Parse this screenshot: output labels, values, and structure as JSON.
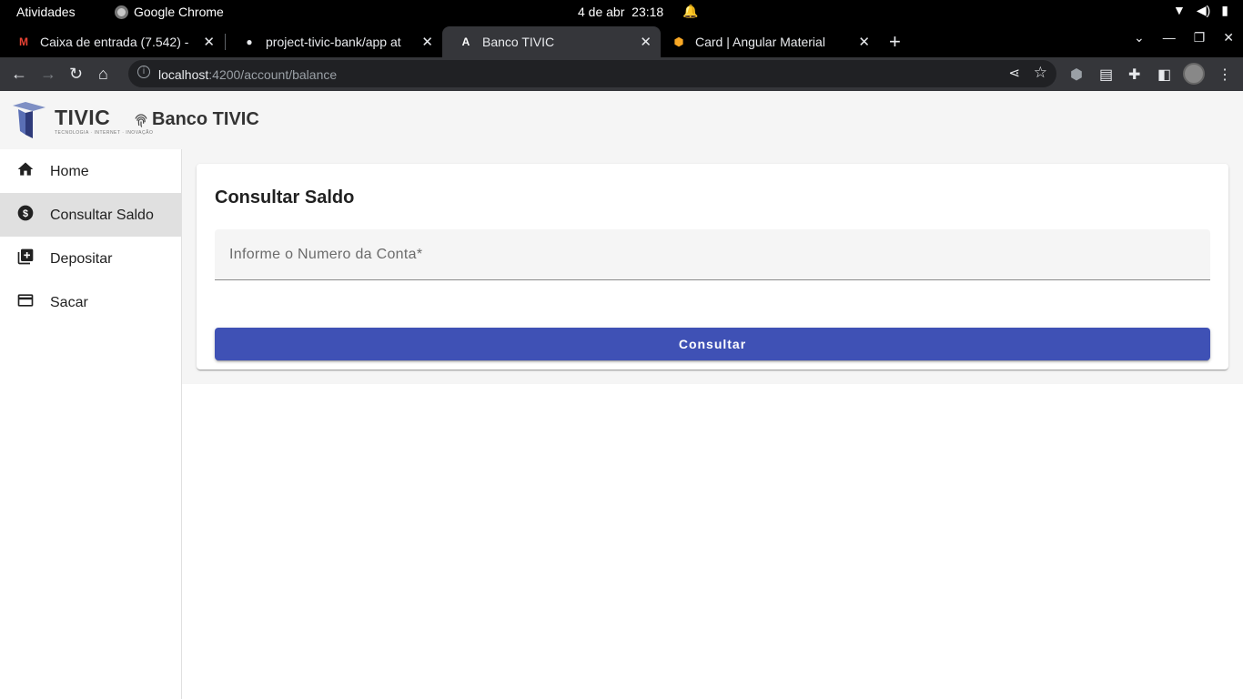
{
  "os_bar": {
    "activities": "Atividades",
    "app_name": "Google Chrome",
    "date": "4 de abr",
    "time": "23:18"
  },
  "browser": {
    "tabs": [
      {
        "title": "Caixa de entrada (7.542) -",
        "favicon": "gmail-icon",
        "favicon_color": "#ea4335"
      },
      {
        "title": "project-tivic-bank/app at",
        "favicon": "github-icon",
        "favicon_color": "#e8eaed"
      },
      {
        "title": "Banco TIVIC",
        "favicon": "angular-icon",
        "favicon_color": "#ffffff"
      },
      {
        "title": "Card | Angular Material",
        "favicon": "shield-icon",
        "favicon_color": "#f9a825"
      }
    ],
    "url_host": "localhost",
    "url_path": ":4200/account/balance"
  },
  "header": {
    "logo_text": "TIVIC",
    "logo_tagline": "TECNOLOGIA · INTERNET · INOVAÇÃO",
    "title": "Banco TIVIC"
  },
  "sidebar": {
    "items": [
      {
        "label": "Home",
        "icon": "home-icon"
      },
      {
        "label": "Consultar Saldo",
        "icon": "dollar-icon"
      },
      {
        "label": "Depositar",
        "icon": "add-box-icon"
      },
      {
        "label": "Sacar",
        "icon": "credit-card-icon"
      }
    ],
    "active_index": 1
  },
  "main": {
    "card_title": "Consultar Saldo",
    "account_field": {
      "placeholder": "Informe o Numero da Conta*",
      "value": ""
    },
    "submit_label": "Consultar"
  },
  "colors": {
    "primary": "#3f51b5",
    "sidebar_active": "#e0e0e0",
    "header_bg": "#f5f5f5"
  }
}
